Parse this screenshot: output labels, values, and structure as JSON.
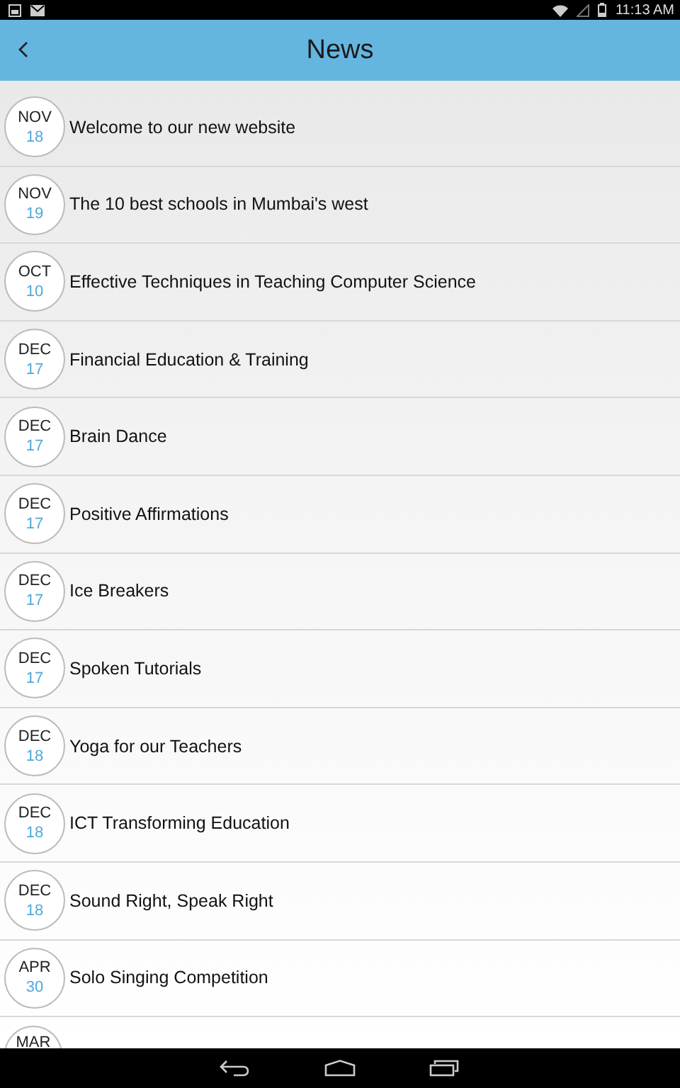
{
  "status_bar": {
    "time": "11:13 AM"
  },
  "header": {
    "title": "News"
  },
  "news": [
    {
      "month": "NOV",
      "day": "18",
      "title": "Welcome to our new website"
    },
    {
      "month": "NOV",
      "day": "19",
      "title": "The 10 best schools in Mumbai's west"
    },
    {
      "month": "OCT",
      "day": "10",
      "title": "Effective Techniques in Teaching Computer Science"
    },
    {
      "month": "DEC",
      "day": "17",
      "title": "Financial Education & Training"
    },
    {
      "month": "DEC",
      "day": "17",
      "title": "Brain Dance"
    },
    {
      "month": "DEC",
      "day": "17",
      "title": "Positive Affirmations"
    },
    {
      "month": "DEC",
      "day": "17",
      "title": "Ice Breakers"
    },
    {
      "month": "DEC",
      "day": "17",
      "title": "Spoken Tutorials"
    },
    {
      "month": "DEC",
      "day": "18",
      "title": "Yoga for our Teachers"
    },
    {
      "month": "DEC",
      "day": "18",
      "title": "ICT Transforming Education"
    },
    {
      "month": "DEC",
      "day": "18",
      "title": "Sound Right, Speak Right"
    },
    {
      "month": "APR",
      "day": "30",
      "title": "Solo Singing Competition"
    },
    {
      "month": "MAR"
    }
  ]
}
